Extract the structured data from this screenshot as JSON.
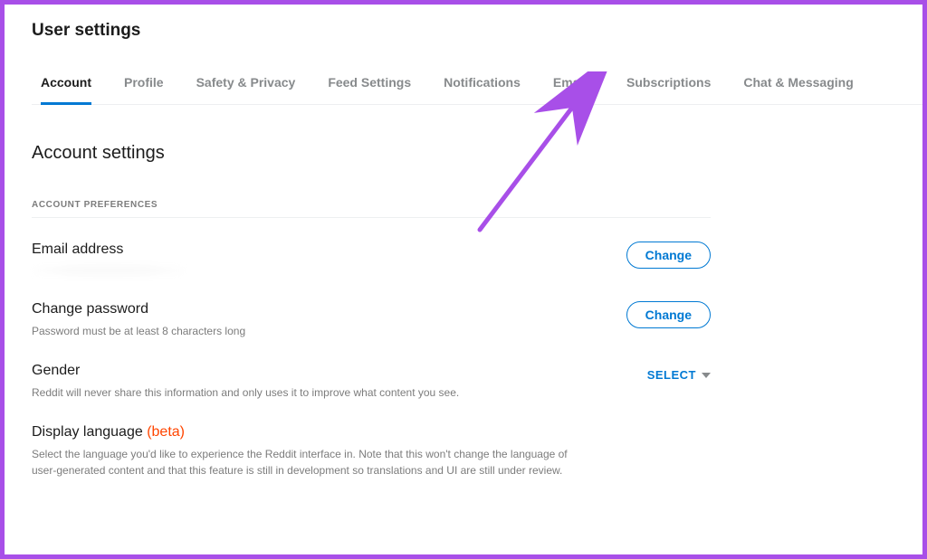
{
  "header": {
    "title": "User settings"
  },
  "tabs": [
    {
      "label": "Account",
      "active": true
    },
    {
      "label": "Profile"
    },
    {
      "label": "Safety & Privacy"
    },
    {
      "label": "Feed Settings"
    },
    {
      "label": "Notifications"
    },
    {
      "label": "Emails"
    },
    {
      "label": "Subscriptions"
    },
    {
      "label": "Chat & Messaging"
    }
  ],
  "section": {
    "title": "Account settings"
  },
  "prefs": {
    "section_label": "ACCOUNT PREFERENCES",
    "email": {
      "title": "Email address",
      "button": "Change"
    },
    "password": {
      "title": "Change password",
      "desc": "Password must be at least 8 characters long",
      "button": "Change"
    },
    "gender": {
      "title": "Gender",
      "desc": "Reddit will never share this information and only uses it to improve what content you see.",
      "select": "SELECT"
    },
    "language": {
      "title": "Display language ",
      "beta": "(beta)",
      "desc": "Select the language you'd like to experience the Reddit interface in. Note that this won't change the language of user-generated content and that this feature is still in development so translations and UI are still under review."
    }
  },
  "colors": {
    "accent": "#0079d3",
    "annotation": "#a84fe8",
    "beta": "#ff4500"
  }
}
